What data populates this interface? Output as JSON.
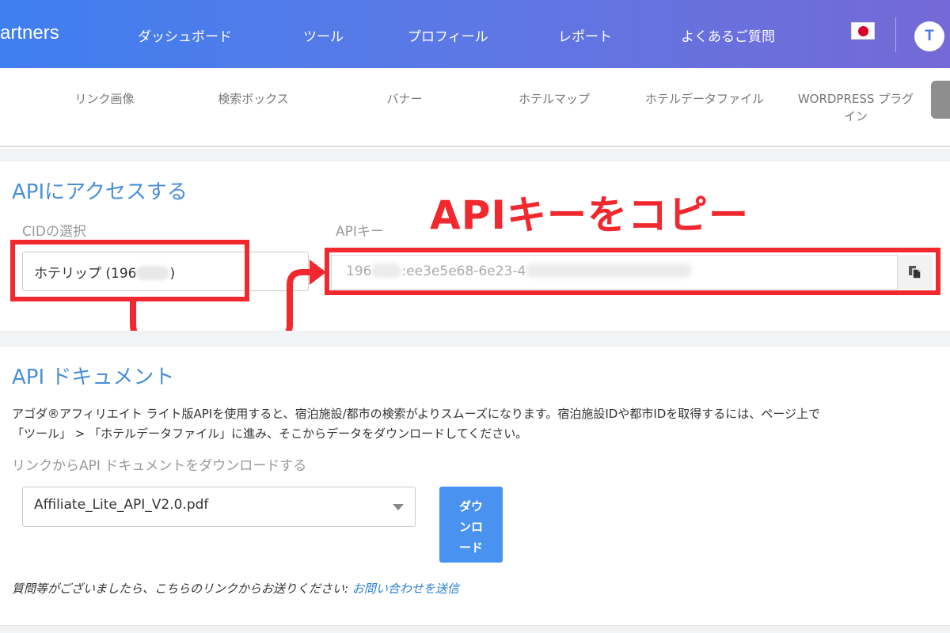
{
  "header": {
    "brand": "artners",
    "nav": [
      "ダッシュボード",
      "ツール",
      "プロフィール",
      "レポート",
      "よくあるご質問"
    ],
    "avatar_initial": "T",
    "flag_icon": "japan-flag-icon"
  },
  "subnav": {
    "items": [
      "リンク画像",
      "検索ボックス",
      "バナー",
      "ホテルマップ",
      "ホテルデータファイル",
      "WORDPRESS プラグ\nイン"
    ]
  },
  "api_access": {
    "title": "APIにアクセスする",
    "cid_label": "CIDの選択",
    "cid_value_prefix": "ホテリップ (196",
    "cid_value_suffix": ")",
    "key_label": "APIキー",
    "key_prefix": "196",
    "key_visible": ":ee3e5e68-6e23-4",
    "copy_icon": "copy-icon"
  },
  "annotation": {
    "text": "APIキーをコピー",
    "color": "#f2282f"
  },
  "api_docs": {
    "title": "API ドキュメント",
    "description_line1": "アゴダ®アフィリエイト ライト版APIを使用すると、宿泊施設/都市の検索がよりスムーズになります。宿泊施設IDや都市IDを取得するには、ページ上で",
    "description_line2": "「ツール」 > 「ホテルデータファイル」に進み、そこからデータをダウンロードしてください。",
    "download_label": "リンクからAPI ドキュメントをダウンロードする",
    "file_selected": "Affiliate_Lite_API_V2.0.pdf",
    "download_button": "ダウ\nンロ\nード",
    "footer_text": "質問等がございましたら、こちらのリンクからお送りください: ",
    "footer_link": "お問い合わせを送信"
  },
  "colors": {
    "header_gradient_start": "#3f7ff0",
    "header_gradient_end": "#7469d6",
    "section_title": "#4a8fd8",
    "download_button": "#4a92f0",
    "link": "#2a7fd4"
  }
}
